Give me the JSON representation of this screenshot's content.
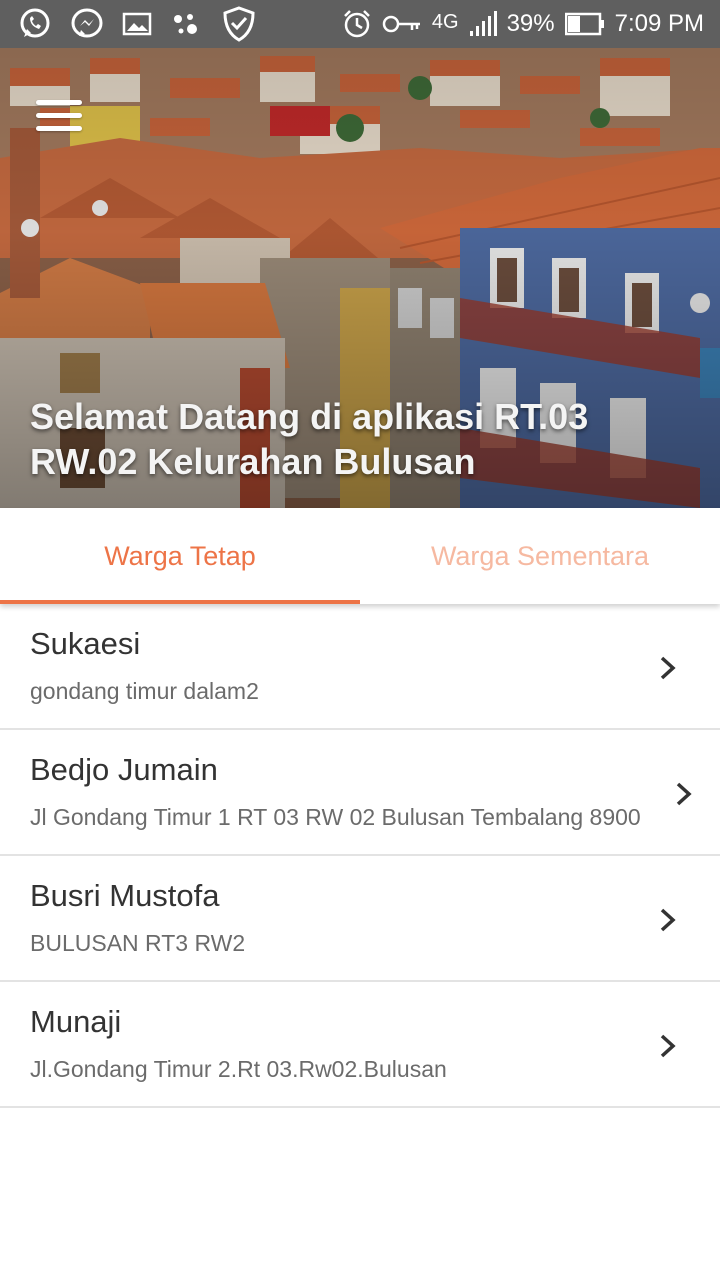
{
  "status_bar": {
    "network": "4G",
    "battery_percent": "39%",
    "time": "7:09 PM",
    "left_icons": [
      "whatsapp-icon",
      "messenger-icon",
      "gallery-icon",
      "assistant-icon",
      "shield-check-icon"
    ],
    "right_icons": [
      "alarm-icon",
      "key-icon",
      "signal-icon",
      "battery-icon"
    ]
  },
  "header": {
    "title": "Selamat Datang di aplikasi RT.03 RW.02 Kelurahan Bulusan",
    "menu_icon": "hamburger-menu-icon"
  },
  "tabs": [
    {
      "label": "Warga Tetap",
      "active": true
    },
    {
      "label": "Warga Sementara",
      "active": false
    }
  ],
  "residents": [
    {
      "name": "Sukaesi",
      "address": "gondang timur dalam2"
    },
    {
      "name": "Bedjo Jumain",
      "address": "Jl Gondang Timur 1 RT 03 RW 02 Bulusan Tembalang 8900"
    },
    {
      "name": "Busri Mustofa",
      "address": "BULUSAN RT3 RW2"
    },
    {
      "name": "Munaji",
      "address": "Jl.Gondang Timur 2.Rt 03.Rw02.Bulusan"
    }
  ],
  "colors": {
    "accent": "#ed7447",
    "accent_inactive": "#f6b9a1",
    "status_bar": "#5f5f5f"
  }
}
